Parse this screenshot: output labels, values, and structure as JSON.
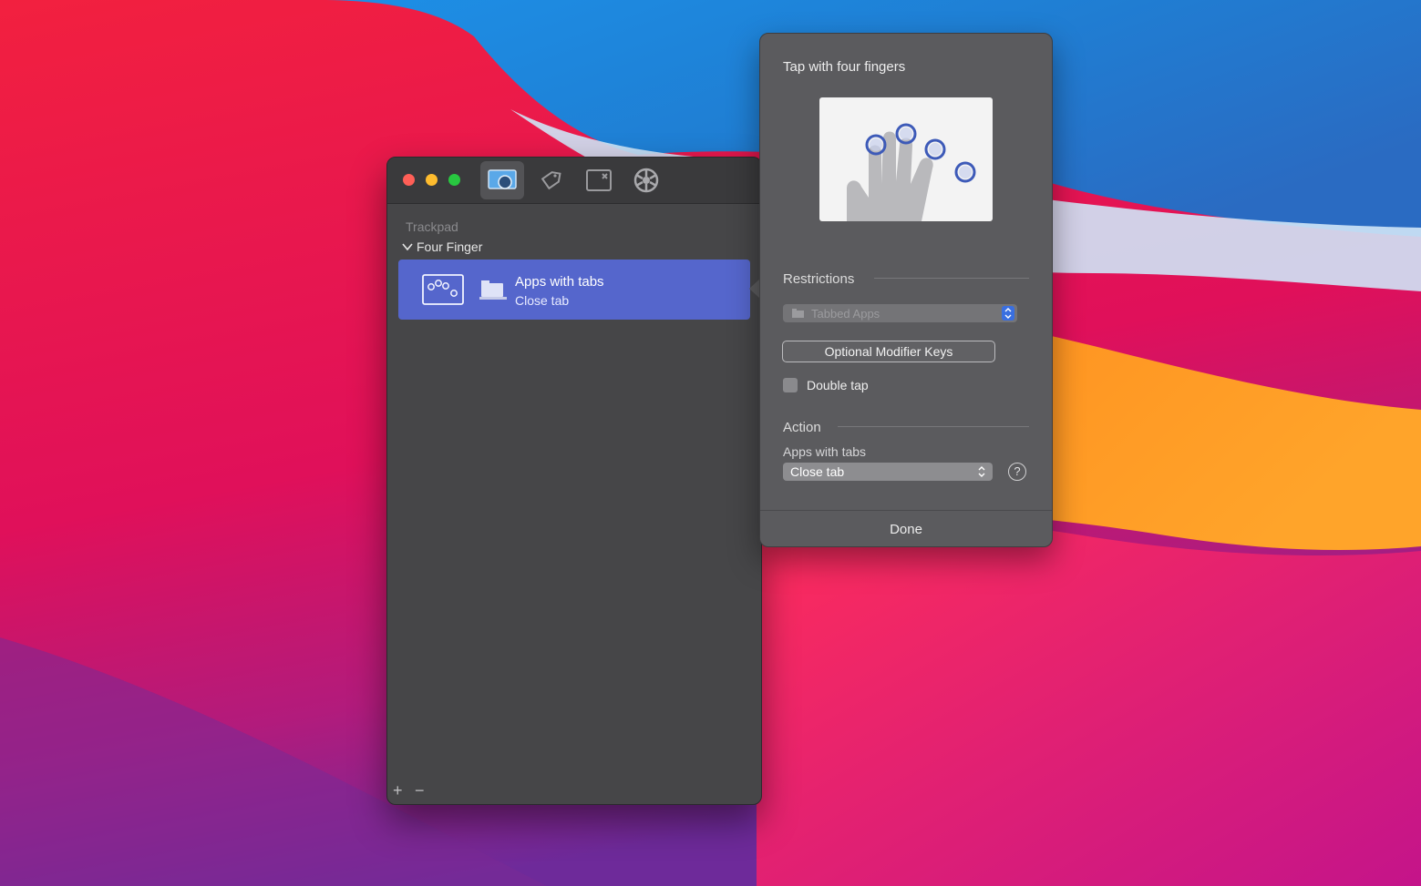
{
  "colors": {
    "accent": "#5566cc",
    "window_bg": "#464648",
    "popover_bg": "#5b5b5e",
    "traffic_red": "#ff5f57",
    "traffic_yellow": "#febc2e",
    "traffic_green": "#28c840"
  },
  "toolbar": {
    "tabs": [
      {
        "icon": "trackpad-gesture-icon",
        "active": true
      },
      {
        "icon": "tag-icon",
        "active": false
      },
      {
        "icon": "window-close-box-icon",
        "active": false
      },
      {
        "icon": "gear-icon",
        "active": false
      }
    ]
  },
  "sidebar": {
    "section": "Trackpad",
    "group": "Four Finger",
    "gesture": {
      "app": "Apps with tabs",
      "action": "Close tab",
      "gesture_icon": "four-finger-tap-icon",
      "app_icon": "tabbed-window-icon"
    },
    "add_label": "+",
    "remove_label": "−"
  },
  "popover": {
    "title": "Tap with four fingers",
    "preview_icon": "four-finger-hand-illustration",
    "restrictions_label": "Restrictions",
    "restriction_select": "Tabbed Apps",
    "modifier_button": "Optional Modifier Keys",
    "double_tap_label": "Double tap",
    "double_tap_checked": false,
    "action_label": "Action",
    "action_app_label": "Apps with tabs",
    "action_select": "Close tab",
    "help_label": "?",
    "done_label": "Done"
  }
}
